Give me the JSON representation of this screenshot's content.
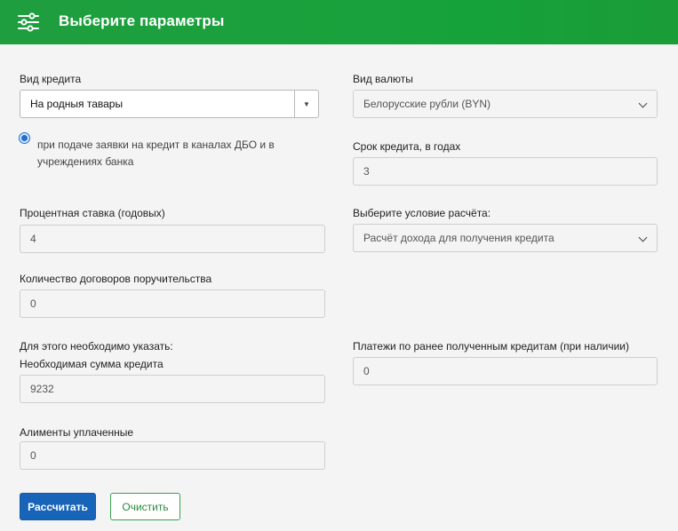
{
  "header": {
    "title": "Выберите параметры",
    "icon": "sliders-icon"
  },
  "credit_type": {
    "label": "Вид кредита",
    "value": "На родныя тавары"
  },
  "currency": {
    "label": "Вид валюты",
    "value": "Белорусские рубли (BYN)"
  },
  "channel_option": {
    "text": "при подаче заявки на кредит в каналах ДБО и в учреждениях банка",
    "selected": true
  },
  "term": {
    "label": "Срок кредита, в годах",
    "value": "3"
  },
  "rate": {
    "label": "Процентная ставка (годовых)",
    "value": "4"
  },
  "calc_condition": {
    "label": "Выберите условие расчёта:",
    "value": "Расчёт дохода для получения кредита"
  },
  "guarantees": {
    "label": "Количество договоров поручительства",
    "value": "0"
  },
  "required_note": "Для этого необходимо указать:",
  "amount": {
    "label": "Необходимая сумма кредита",
    "value": "9232"
  },
  "prev_payments": {
    "label": "Платежи по ранее полученным  кредитам (при наличии)",
    "value": "0"
  },
  "alimony": {
    "label": "Алименты уплаченные",
    "value": "0"
  },
  "buttons": {
    "calculate": "Рассчитать",
    "clear": "Очистить"
  },
  "colors": {
    "header": "#16a23b",
    "primary": "#1864b8",
    "secondary_border": "#3aa24a"
  }
}
